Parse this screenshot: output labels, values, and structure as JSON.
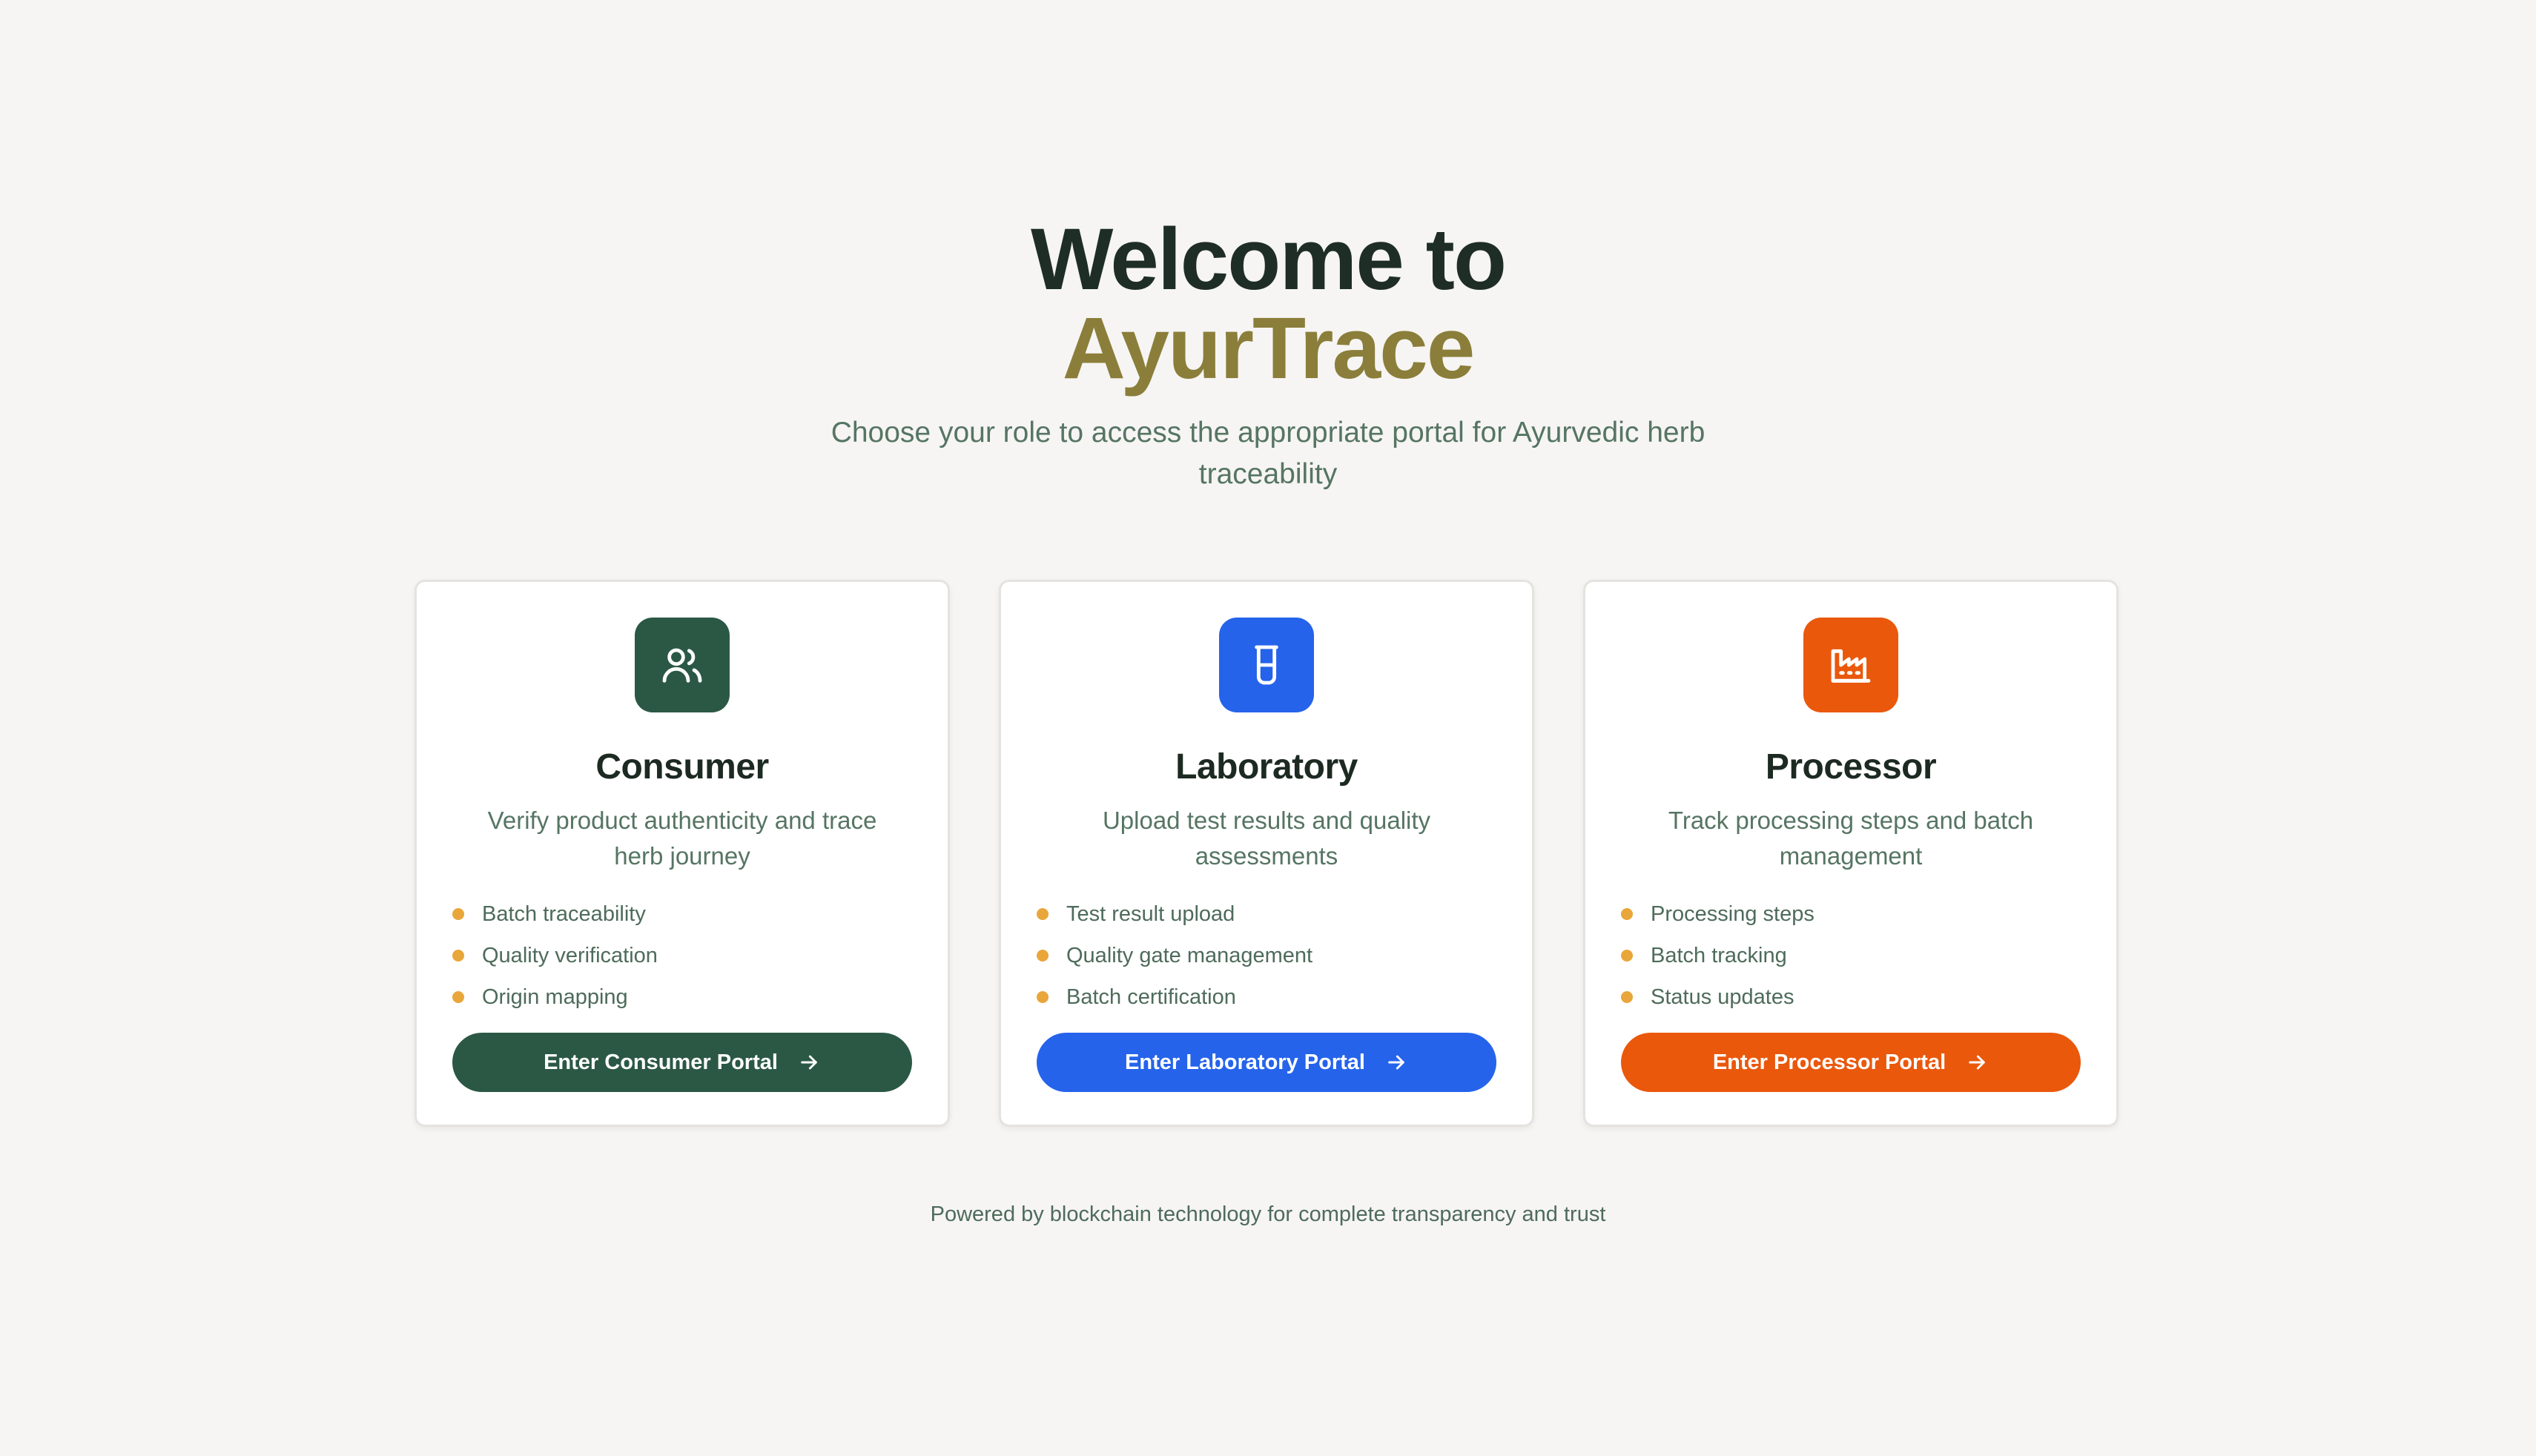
{
  "hero": {
    "title_line1": "Welcome to",
    "title_line2": "AyurTrace",
    "subtitle": "Choose your role to access the appropriate portal for Ayurvedic herb traceability"
  },
  "cards": [
    {
      "title": "Consumer",
      "description": "Verify product authenticity and trace herb journey",
      "icon": "users-icon",
      "accent_color": "#2b5845",
      "features": [
        "Batch traceability",
        "Quality verification",
        "Origin mapping"
      ],
      "button_label": "Enter Consumer Portal"
    },
    {
      "title": "Laboratory",
      "description": "Upload test results and quality assessments",
      "icon": "beaker-icon",
      "accent_color": "#2563eb",
      "features": [
        "Test result upload",
        "Quality gate management",
        "Batch certification"
      ],
      "button_label": "Enter Laboratory Portal"
    },
    {
      "title": "Processor",
      "description": "Track processing steps and batch management",
      "icon": "factory-icon",
      "accent_color": "#ea580c",
      "features": [
        "Processing steps",
        "Batch tracking",
        "Status updates"
      ],
      "button_label": "Enter Processor Portal"
    }
  ],
  "footer": {
    "text": "Powered by blockchain technology for complete transparency and trust"
  },
  "colors": {
    "background": "#f6f5f3",
    "brand_text": "#8a7e3a",
    "bullet": "#e9a63a"
  }
}
